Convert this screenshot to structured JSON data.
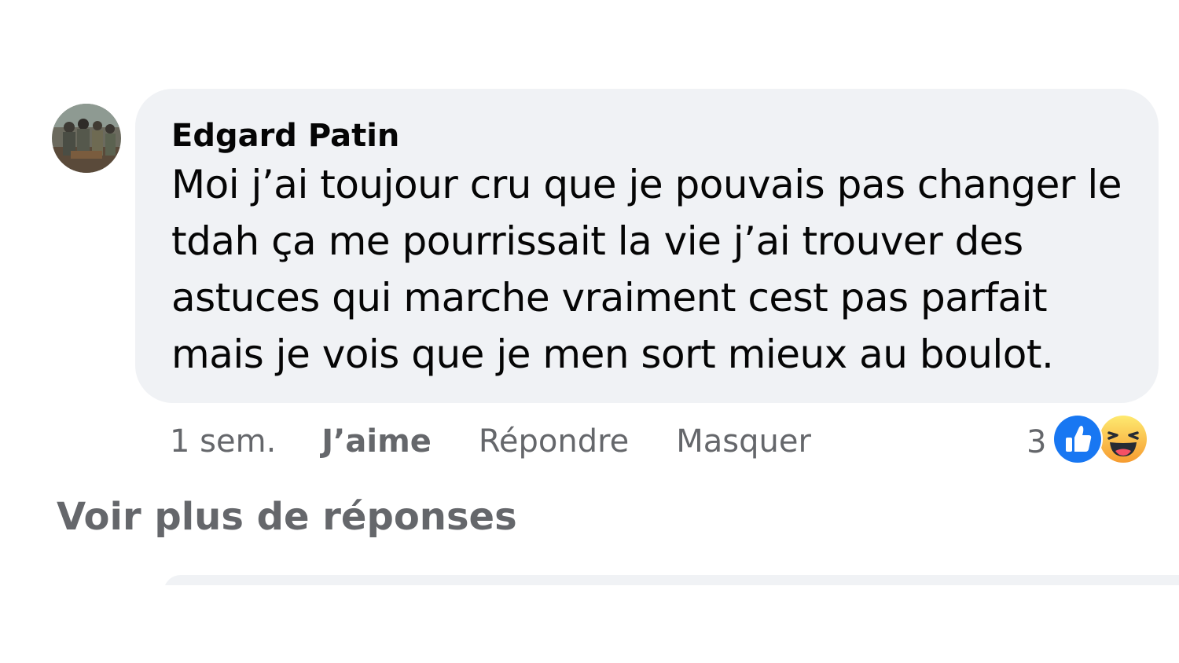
{
  "comment": {
    "author": "Edgard Patin",
    "text": "Moi j’ai toujour cru que je pouvais pas changer le tdah ça me pourrissait la vie j’ai trouver des astuces qui marche vraiment cest pas parfait mais je vois que je men sort mieux au boulot.",
    "avatar_icon": "user-photo-avatar",
    "bubble_color": "#f0f2f5",
    "text_color": "#050505"
  },
  "actions": {
    "time": "1 sem.",
    "like_label": "J’aime",
    "reply_label": "Répondre",
    "hide_label": "Masquer",
    "muted_color": "#65676b"
  },
  "reactions": {
    "count": "3",
    "icons": [
      "like-reaction-icon",
      "haha-reaction-icon"
    ],
    "like_color": "#1877f2",
    "haha_color": "#f7b125"
  },
  "more_replies": {
    "label": "Voir plus de réponses"
  }
}
